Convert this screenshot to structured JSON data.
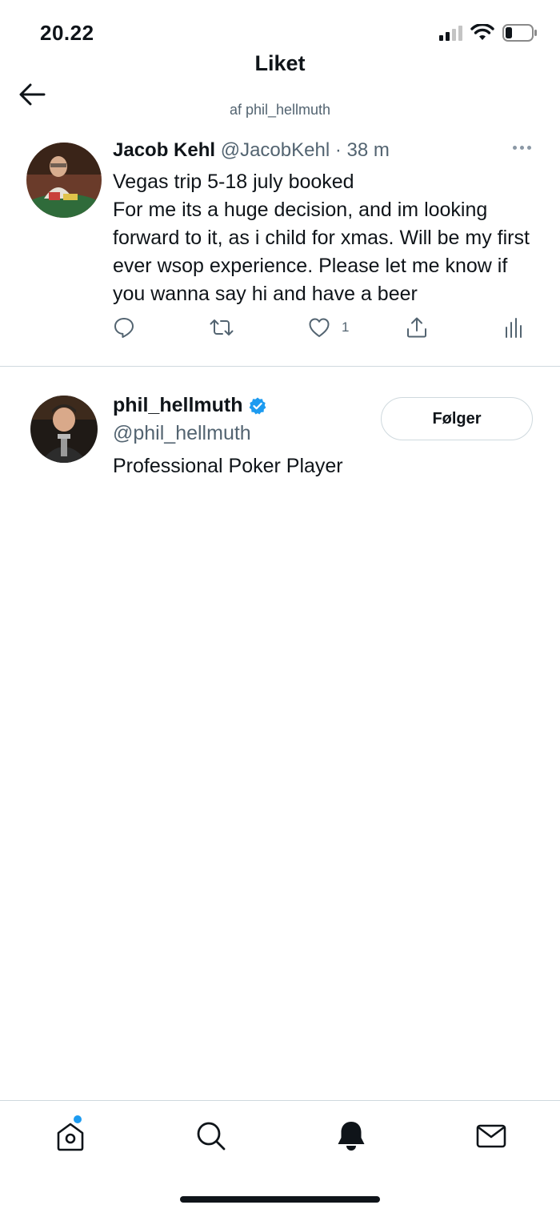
{
  "status_bar": {
    "time": "20.22"
  },
  "header": {
    "title": "Liket",
    "subtitle": "af phil_hellmuth"
  },
  "tweet": {
    "author_name": "Jacob Kehl",
    "author_handle": "@JacobKehl",
    "separator": "·",
    "time": "38 m",
    "text": "Vegas trip 5-18 july booked\nFor me its a huge decision, and im looking forward to it, as i child for xmas. Will be my first ever wsop experience. Please let me know if you wanna say hi and have a beer",
    "like_count": "1",
    "icons": [
      "reply-icon",
      "retweet-icon",
      "like-icon",
      "share-icon",
      "analytics-icon"
    ]
  },
  "user_card": {
    "name": "phil_hellmuth",
    "handle": "@phil_hellmuth",
    "bio": "Professional Poker Player",
    "follow_label": "Følger",
    "verified": true
  },
  "bottom_nav": {
    "items": [
      "home-icon",
      "search-icon",
      "notifications-icon",
      "messages-icon"
    ],
    "active": "notifications-icon",
    "home_has_new": true
  },
  "colors": {
    "accent": "#1d9bf0",
    "text": "#0f1419",
    "secondary": "#536471",
    "border": "#cfd9de"
  }
}
